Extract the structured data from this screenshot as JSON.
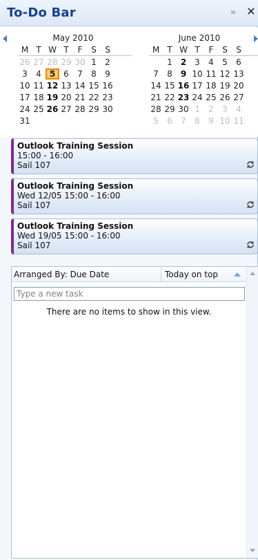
{
  "header": {
    "title": "To-Do Bar",
    "expand_glyph": "»",
    "close_glyph": "✕"
  },
  "calendar": {
    "weekday_labels": [
      "M",
      "T",
      "W",
      "T",
      "F",
      "S",
      "S"
    ],
    "months": [
      {
        "name": "May 2010",
        "weeks": [
          [
            {
              "d": "26",
              "o": true
            },
            {
              "d": "27",
              "o": true
            },
            {
              "d": "28",
              "o": true
            },
            {
              "d": "29",
              "o": true
            },
            {
              "d": "30",
              "o": true
            },
            {
              "d": "1"
            },
            {
              "d": "2"
            }
          ],
          [
            {
              "d": "3"
            },
            {
              "d": "4"
            },
            {
              "d": "5",
              "today": true
            },
            {
              "d": "6"
            },
            {
              "d": "7"
            },
            {
              "d": "8"
            },
            {
              "d": "9"
            }
          ],
          [
            {
              "d": "10"
            },
            {
              "d": "11"
            },
            {
              "d": "12",
              "b": true
            },
            {
              "d": "13"
            },
            {
              "d": "14"
            },
            {
              "d": "15"
            },
            {
              "d": "16"
            }
          ],
          [
            {
              "d": "17"
            },
            {
              "d": "18"
            },
            {
              "d": "19",
              "b": true
            },
            {
              "d": "20"
            },
            {
              "d": "21"
            },
            {
              "d": "22"
            },
            {
              "d": "23"
            }
          ],
          [
            {
              "d": "24"
            },
            {
              "d": "25"
            },
            {
              "d": "26",
              "b": true
            },
            {
              "d": "27"
            },
            {
              "d": "28"
            },
            {
              "d": "29"
            },
            {
              "d": "30"
            }
          ],
          [
            {
              "d": "31"
            },
            {
              "d": ""
            },
            {
              "d": ""
            },
            {
              "d": ""
            },
            {
              "d": ""
            },
            {
              "d": ""
            },
            {
              "d": ""
            }
          ]
        ]
      },
      {
        "name": "June 2010",
        "weeks": [
          [
            {
              "d": ""
            },
            {
              "d": "1"
            },
            {
              "d": "2",
              "b": true
            },
            {
              "d": "3"
            },
            {
              "d": "4"
            },
            {
              "d": "5"
            },
            {
              "d": "6"
            }
          ],
          [
            {
              "d": "7"
            },
            {
              "d": "8"
            },
            {
              "d": "9",
              "b": true
            },
            {
              "d": "10"
            },
            {
              "d": "11"
            },
            {
              "d": "12"
            },
            {
              "d": "13"
            }
          ],
          [
            {
              "d": "14"
            },
            {
              "d": "15"
            },
            {
              "d": "16",
              "b": true
            },
            {
              "d": "17"
            },
            {
              "d": "18"
            },
            {
              "d": "19"
            },
            {
              "d": "20"
            }
          ],
          [
            {
              "d": "21"
            },
            {
              "d": "22"
            },
            {
              "d": "23",
              "b": true
            },
            {
              "d": "24"
            },
            {
              "d": "25"
            },
            {
              "d": "26"
            },
            {
              "d": "27"
            }
          ],
          [
            {
              "d": "28"
            },
            {
              "d": "29"
            },
            {
              "d": "30"
            },
            {
              "d": "1",
              "o": true
            },
            {
              "d": "2",
              "o": true
            },
            {
              "d": "3",
              "o": true
            },
            {
              "d": "4",
              "o": true
            }
          ],
          [
            {
              "d": "5",
              "o": true
            },
            {
              "d": "6",
              "o": true
            },
            {
              "d": "7",
              "o": true
            },
            {
              "d": "8",
              "o": true
            },
            {
              "d": "9",
              "o": true
            },
            {
              "d": "10",
              "o": true
            },
            {
              "d": "11",
              "o": true
            }
          ]
        ]
      }
    ]
  },
  "appointments": [
    {
      "title": "Outlook Training Session",
      "time": "15:00 - 16:00",
      "location": "Sail 107",
      "category_color": "#7b2b8f"
    },
    {
      "title": "Outlook Training Session",
      "time": "Wed 12/05 15:00 - 16:00",
      "location": "Sail 107",
      "category_color": "#7b2b8f"
    },
    {
      "title": "Outlook Training Session",
      "time": "Wed 19/05 15:00 - 16:00",
      "location": "Sail 107",
      "category_color": "#7b2b8f"
    }
  ],
  "tasks": {
    "arranged_by": "Arranged By: Due Date",
    "sort_order": "Today on top",
    "new_task_placeholder": "Type a new task",
    "empty_message": "There are no items to show in this view."
  }
}
